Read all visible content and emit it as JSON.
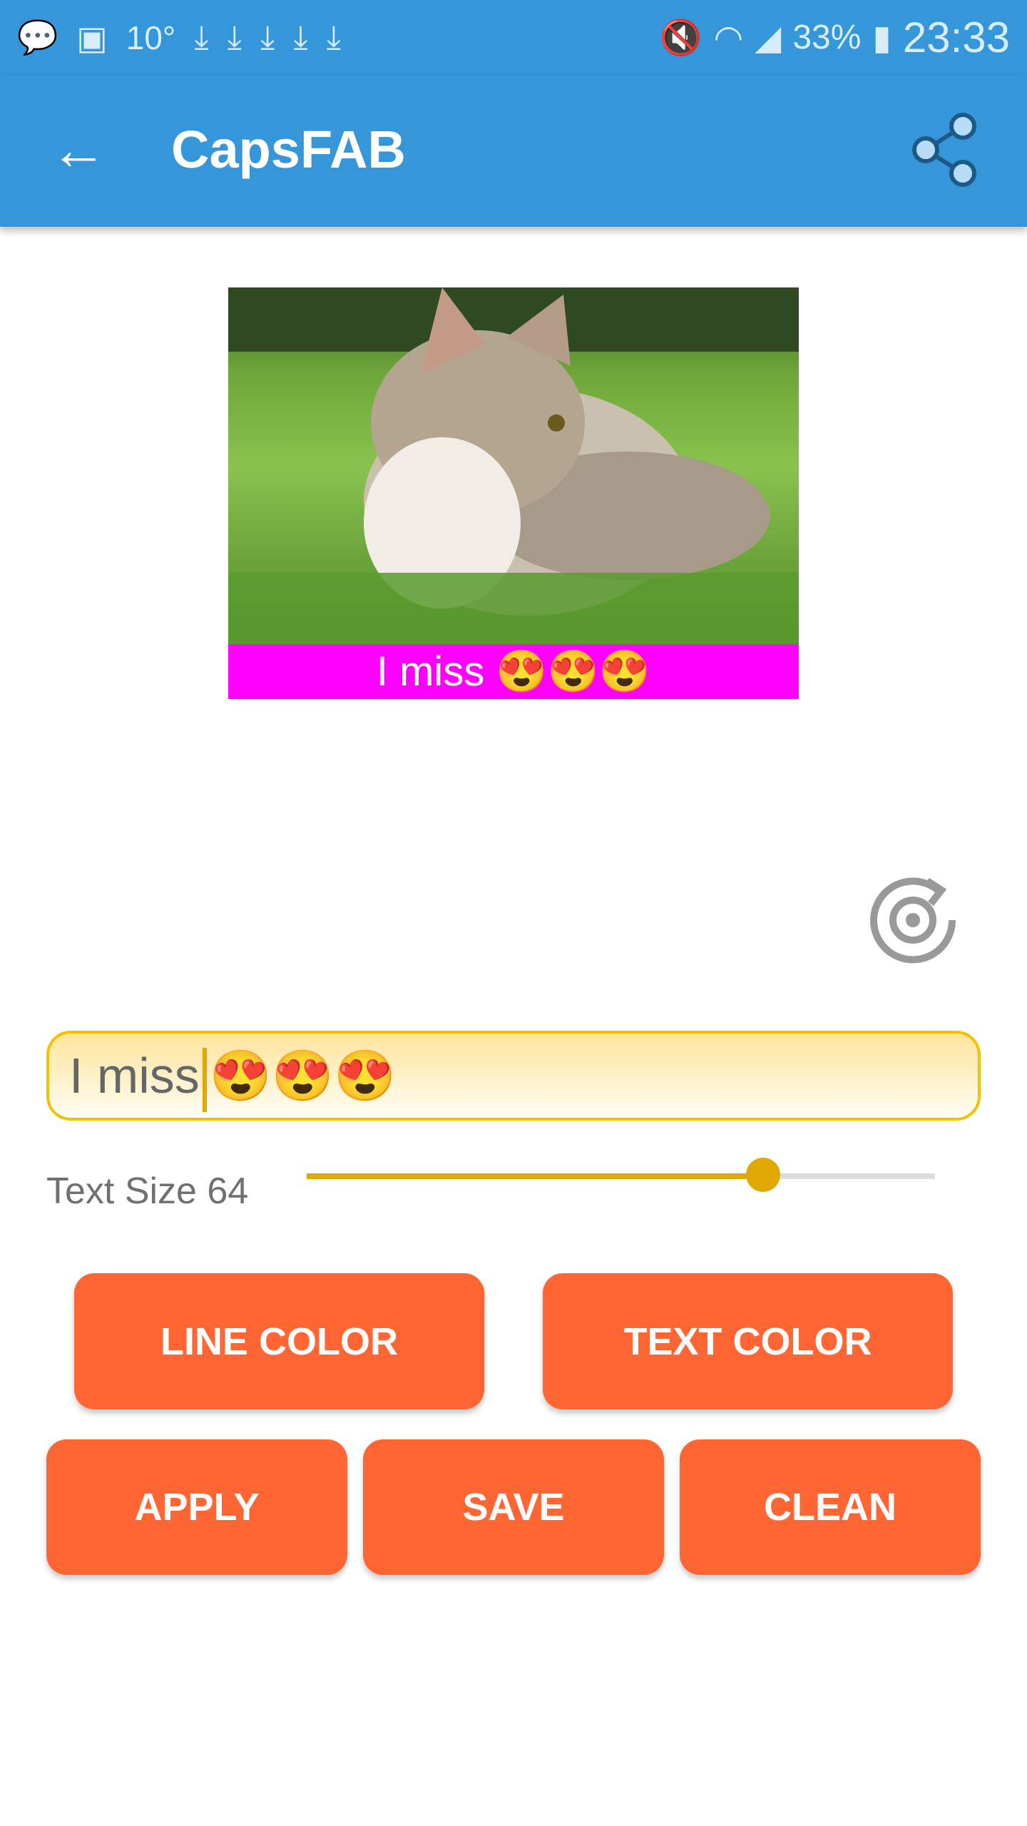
{
  "status_bar": {
    "temperature": "10°",
    "battery": "33%",
    "time": "23:33",
    "icons": [
      "messages-icon",
      "gallery-icon",
      "download-icon",
      "download-icon",
      "download-icon",
      "download-icon",
      "download-icon",
      "mute-icon",
      "wifi-icon",
      "signal-icon",
      "battery-charging-icon"
    ]
  },
  "app_bar": {
    "title": "CapsFAB",
    "back_icon": "arrow-left-icon",
    "share_icon": "share-icon"
  },
  "preview": {
    "caption": "I miss 😍😍😍",
    "caption_bg": "#ff00ff"
  },
  "editor": {
    "text_value": "I miss",
    "text_emoji": "😍😍😍"
  },
  "text_size": {
    "label": "Text Size 64",
    "value": 64,
    "slider_fraction": 0.726
  },
  "buttons": {
    "line_color": "LINE COLOR",
    "text_color": "TEXT COLOR",
    "apply": "APPLY",
    "save": "SAVE",
    "clean": "CLEAN"
  },
  "colors": {
    "primary": "#3597d9",
    "accent": "#ff6633",
    "slider": "#e0a800"
  }
}
